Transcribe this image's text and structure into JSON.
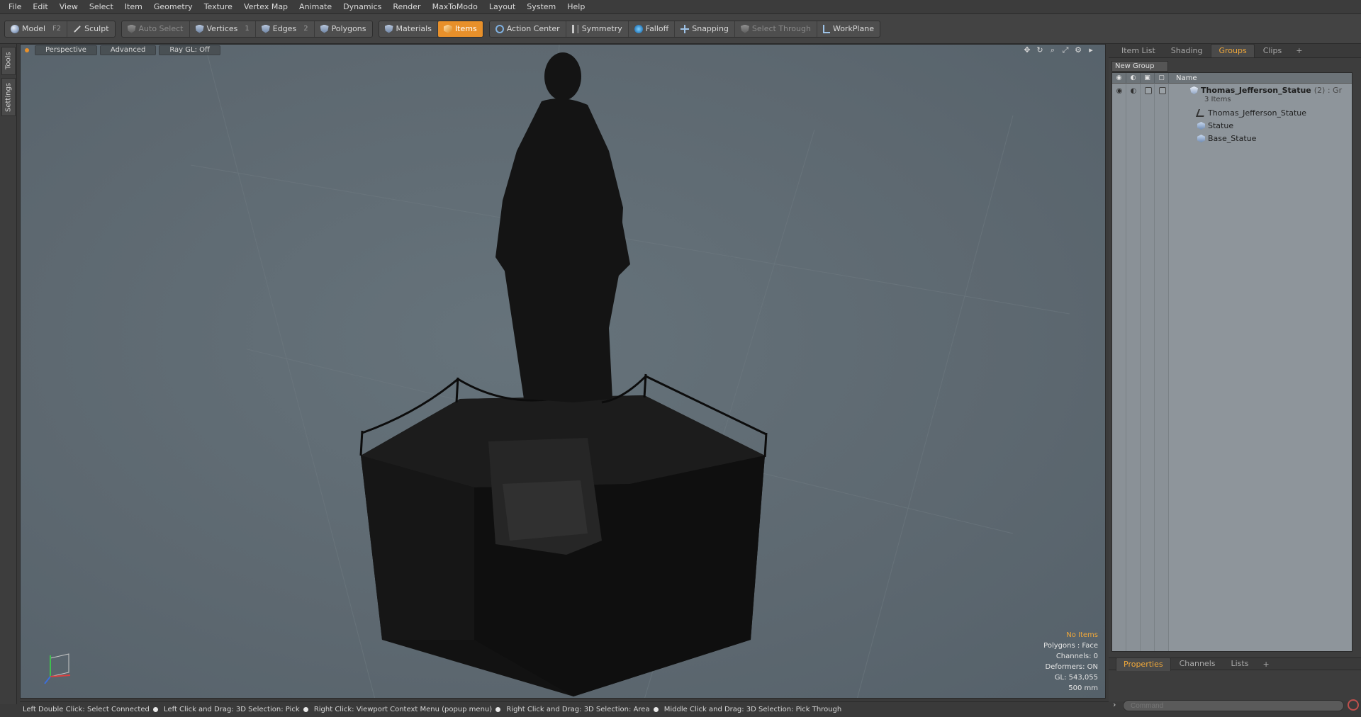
{
  "menubar": {
    "items": [
      "File",
      "Edit",
      "View",
      "Select",
      "Item",
      "Geometry",
      "Texture",
      "Vertex Map",
      "Animate",
      "Dynamics",
      "Render",
      "MaxToModo",
      "Layout",
      "System",
      "Help"
    ]
  },
  "toolbar": {
    "model": "Model",
    "model_key": "F2",
    "sculpt": "Sculpt",
    "auto_select": "Auto Select",
    "vertices": "Vertices",
    "vertices_key": "1",
    "edges": "Edges",
    "edges_key": "2",
    "polygons": "Polygons",
    "materials": "Materials",
    "items": "Items",
    "action_center": "Action Center",
    "symmetry": "Symmetry",
    "falloff": "Falloff",
    "snapping": "Snapping",
    "select_through": "Select Through",
    "workplane": "WorkPlane",
    "accent": "#e8902a"
  },
  "sidetabs": {
    "tools": "Tools",
    "settings": "Settings"
  },
  "viewport": {
    "view_mode": "Perspective",
    "shading": "Advanced",
    "raygl": "Ray GL: Off",
    "info": {
      "selection": "No Items",
      "polygons": "Polygons : Face",
      "channels": "Channels: 0",
      "deformers": "Deformers: ON",
      "gl": "GL: 543,055",
      "scale": "500 mm"
    },
    "background_color": "#5f6a72",
    "model_color": "#161616"
  },
  "right_panel": {
    "tabs": [
      "Item List",
      "Shading",
      "Groups",
      "Clips"
    ],
    "active_tab": "Groups",
    "add_tab": "+",
    "new_group": "New Group",
    "column_name": "Name",
    "tree": {
      "group_name": "Thomas_Jefferson_Statue",
      "group_meta": "(2) : Gr",
      "group_count": "3 Items",
      "children": [
        {
          "name": "Thomas_Jefferson_Statue",
          "icon": "locator-icon"
        },
        {
          "name": "Statue",
          "icon": "mesh-icon"
        },
        {
          "name": "Base_Statue",
          "icon": "mesh-icon"
        }
      ]
    },
    "bottom_tabs": [
      "Properties",
      "Channels",
      "Lists"
    ],
    "bottom_active": "Properties",
    "command_placeholder": "Command"
  },
  "statusbar": {
    "hints": [
      "Left Double Click: Select Connected",
      "Left Click and Drag: 3D Selection: Pick",
      "Right Click: Viewport Context Menu (popup menu)",
      "Right Click and Drag: 3D Selection: Area",
      "Middle Click and Drag: 3D Selection: Pick Through"
    ]
  }
}
